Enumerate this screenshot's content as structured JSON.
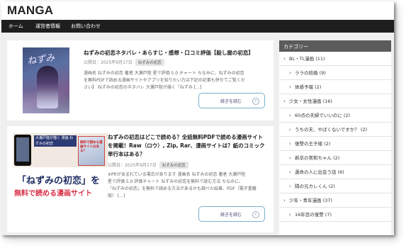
{
  "site": {
    "title": "MANGA"
  },
  "nav": {
    "items": [
      "ホーム",
      "運営者情報",
      "お問い合わせ"
    ]
  },
  "posts": [
    {
      "thumb_text": "ねずみ",
      "title": "ねずみの初恋ネタバレ・あらすじ・感想・口コミ評価【殺し屋の初恋】",
      "date": "公開日：2025年9月17日",
      "tag": "ねずみの初恋",
      "excerpt_lines": [
        "漫画名 ねずみの初恋 著者 大瀬戸陸 星で評価 5.0 チャート ちなみに、ねずみの初恋",
        "を無料PDFで読める漫画サイトやアプリを知りたい方は下記の記事も併せてご覧くだ",
        "さい】 ねずみの初恋のネタバレ 大瀬戸陸が描く「ねずみ […]"
      ],
      "read_more": "続きを読む"
    },
    {
      "thumb": {
        "blurb": "大瀬戸陸が描く 漫画 ねずみの初恋",
        "cover_text": "無料で読める漫画サイトはある？",
        "line1": "「ねずみの初恋」を",
        "line2": "無料で読める漫画サイト"
      },
      "title_lines": [
        "ねずみの初恋はどこで読める？全話無料PDFで読める漫画サイト",
        "を掲載！Raw（ロウ）, Zip, Rar、漫画サイトは？紙のコミック",
        "単行本はある？"
      ],
      "date": "公開日：2025年9月17日",
      "tag": "ねずみの初恋",
      "excerpt_lines": [
        "※PRが含まれている場合があります 漫画名 ねずみの初恋 著者 大瀬戸陸",
        "星で評価 5.0 評価チャート ねずみの初恋を無料で読む方法 ちなみに、",
        "「ねずみの初恋」を無料で読める方法があるかも調べた結果、PDF（電子書籍",
        "版） […]"
      ],
      "read_more": "続きを読む"
    }
  ],
  "sidebar": {
    "heading": "カテゴリー",
    "categories": [
      {
        "label": "BL・TL漫画 (11)",
        "level": 0
      },
      {
        "label": "ララの結婚 (9)",
        "level": 1
      },
      {
        "label": "体感予報 (2)",
        "level": 1
      },
      {
        "label": "少女・女性漫画 (16)",
        "level": 0
      },
      {
        "label": "60点の夫婦でいいのに (2)",
        "level": 1
      },
      {
        "label": "うちの夫、やばくないですか？ (2)",
        "level": 1
      },
      {
        "label": "復讐の王子様 (2)",
        "level": 1
      },
      {
        "label": "新卒の美和ちゃん (2)",
        "level": 1
      },
      {
        "label": "運命の人に出会う話 (6)",
        "level": 1
      },
      {
        "label": "隣の元カレくん (2)",
        "level": 1
      },
      {
        "label": "少年・青年漫画 (37)",
        "level": 0
      },
      {
        "label": "16年目の復讐 (7)",
        "level": 1
      }
    ]
  },
  "colors": {
    "nav_bg": "#1e1e1e",
    "sidebar_head_bg": "#5b5b5b",
    "readmore_border": "#7ab0c8",
    "accent_red": "#d9334b"
  }
}
